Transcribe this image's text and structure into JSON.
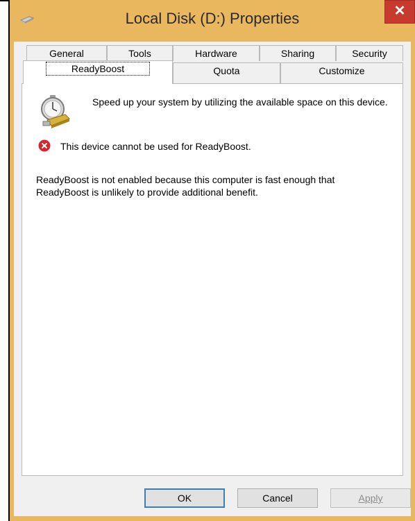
{
  "window": {
    "title": "Local Disk (D:) Properties",
    "close_label": "✕"
  },
  "tabs_row1": [
    {
      "label": "General"
    },
    {
      "label": "Tools"
    },
    {
      "label": "Hardware"
    },
    {
      "label": "Sharing"
    },
    {
      "label": "Security"
    }
  ],
  "tabs_row2": [
    {
      "label": "ReadyBoost",
      "active": true
    },
    {
      "label": "Quota"
    },
    {
      "label": "Customize"
    }
  ],
  "readyboost": {
    "icon": "stopwatch-drive-icon",
    "intro": "Speed up your system by utilizing the available space on this device.",
    "error_icon": "error-icon",
    "error": "This device cannot be used for ReadyBoost.",
    "description": "ReadyBoost is not enabled because this computer is fast enough that ReadyBoost is unlikely to provide additional benefit."
  },
  "buttons": {
    "ok": "OK",
    "cancel": "Cancel",
    "apply": "Apply"
  },
  "colors": {
    "frame": "#e9b75d",
    "close": "#c73b2f",
    "default_button_border": "#3c7fb1"
  }
}
